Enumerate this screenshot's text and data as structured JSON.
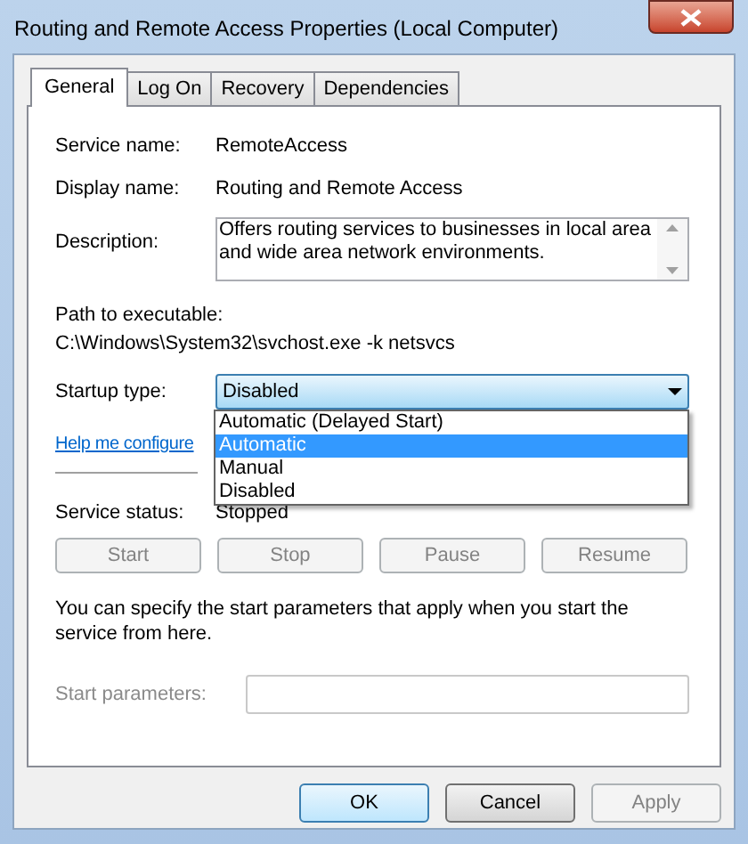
{
  "window": {
    "title": "Routing and Remote Access Properties (Local Computer)"
  },
  "tabs": [
    {
      "label": "General",
      "selected": true
    },
    {
      "label": "Log On",
      "selected": false
    },
    {
      "label": "Recovery",
      "selected": false
    },
    {
      "label": "Dependencies",
      "selected": false
    }
  ],
  "fields": [
    {
      "label": "Service name:",
      "value": "RemoteAccess"
    },
    {
      "label": "Display name:",
      "value": "Routing and Remote Access"
    }
  ],
  "description": {
    "label": "Description:",
    "value": "Offers routing services to businesses in local area and wide area network environments."
  },
  "path": {
    "label": "Path to executable:",
    "value": "C:\\Windows\\System32\\svchost.exe -k netsvcs"
  },
  "startup_type": {
    "label": "Startup type:",
    "value": "Disabled",
    "expanded": true,
    "options": [
      {
        "label": "Automatic (Delayed Start)",
        "highlighted": false
      },
      {
        "label": "Automatic",
        "highlighted": true
      },
      {
        "label": "Manual",
        "highlighted": false
      },
      {
        "label": "Disabled",
        "highlighted": false
      }
    ]
  },
  "help_link": "Help me configure",
  "service_status": {
    "label": "Service status:",
    "value": "Stopped"
  },
  "service_buttons": [
    {
      "label": "Start",
      "disabled": true
    },
    {
      "label": "Stop",
      "disabled": true
    },
    {
      "label": "Pause",
      "disabled": true
    },
    {
      "label": "Resume",
      "disabled": true
    }
  ],
  "note": "You can specify the start parameters that apply when you start the service from here.",
  "start_parameters": {
    "label": "Start parameters:",
    "disabled": true
  },
  "dialog_buttons": [
    {
      "label": "OK",
      "default": true,
      "disabled": false
    },
    {
      "label": "Cancel",
      "default": false,
      "disabled": false
    },
    {
      "label": "Apply",
      "default": false,
      "disabled": true
    }
  ]
}
